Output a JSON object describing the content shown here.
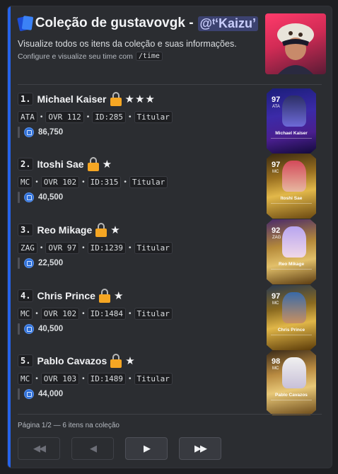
{
  "header": {
    "title": "Coleção de gustavovgk -",
    "mention": "@ᵗ‘Kaizu’",
    "description": "Visualize todos os itens da coleção e suas informações.",
    "sub_description": "Configure e visualize seu time com",
    "command": "/time"
  },
  "players": [
    {
      "rank": "1.",
      "name": "Michael Kaiser",
      "stars": "★★★",
      "position": "ATA",
      "ovr": "OVR 112",
      "id": "ID:285",
      "status": "Titular",
      "value": "86,750",
      "card_ovr": "97",
      "card_pos": "ATA",
      "card_name": "Michael Kaiser"
    },
    {
      "rank": "2.",
      "name": "Itoshi Sae",
      "stars": "★",
      "position": "MC",
      "ovr": "OVR 102",
      "id": "ID:315",
      "status": "Titular",
      "value": "40,500",
      "card_ovr": "97",
      "card_pos": "MC",
      "card_name": "Itoshi Sae"
    },
    {
      "rank": "3.",
      "name": "Reo Mikage",
      "stars": "★",
      "position": "ZAG",
      "ovr": "OVR 97",
      "id": "ID:1239",
      "status": "Titular",
      "value": "22,500",
      "card_ovr": "92",
      "card_pos": "ZAG",
      "card_name": "Reo Mikage"
    },
    {
      "rank": "4.",
      "name": "Chris Prince",
      "stars": "★",
      "position": "MC",
      "ovr": "OVR 102",
      "id": "ID:1484",
      "status": "Titular",
      "value": "40,500",
      "card_ovr": "97",
      "card_pos": "MC",
      "card_name": "Chris Prince"
    },
    {
      "rank": "5.",
      "name": "Pablo Cavazos",
      "stars": "★",
      "position": "MC",
      "ovr": "OVR 103",
      "id": "ID:1489",
      "status": "Titular",
      "value": "44,000",
      "card_ovr": "98",
      "card_pos": "MC",
      "card_name": "Pablo Cavazos"
    }
  ],
  "footer": {
    "pagination": "Página 1/2 — 6 itens na coleção"
  },
  "buttons": {
    "first": "◀◀",
    "prev": "◀",
    "next": "▶",
    "last": "▶▶"
  }
}
